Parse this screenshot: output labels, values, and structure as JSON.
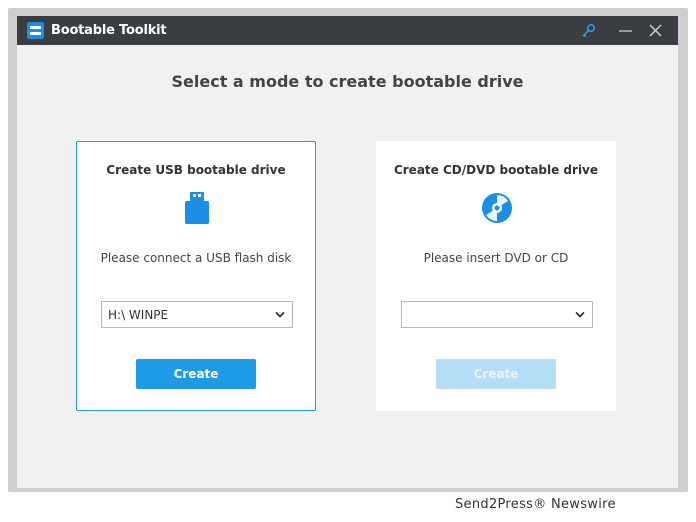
{
  "window": {
    "title": "Bootable Toolkit"
  },
  "main": {
    "title": "Select a mode to create bootable drive"
  },
  "usb": {
    "title": "Create USB bootable drive",
    "description": "Please connect a USB flash disk",
    "selected_drive": "H:\\ WINPE",
    "button_label": "Create",
    "icon": "usb-drive-icon"
  },
  "dvd": {
    "title": "Create CD/DVD bootable drive",
    "description": "Please insert DVD or CD",
    "selected_drive": "",
    "button_label": "Create",
    "icon": "disc-icon"
  },
  "watermark": "Send2Press® Newswire",
  "colors": {
    "accent": "#1d9be6",
    "accent_disabled": "#b5ddf5",
    "titlebar": "#3a3d42",
    "icon_blue": "#1a8fe3"
  }
}
